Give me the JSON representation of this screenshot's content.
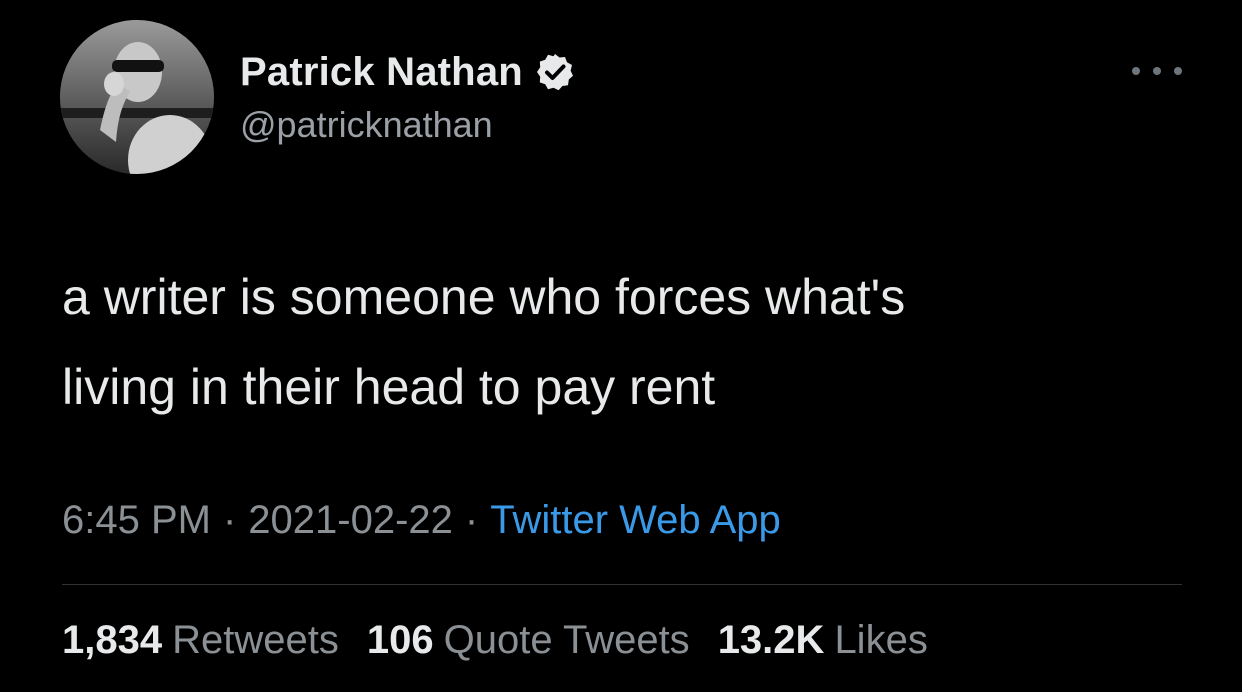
{
  "user": {
    "display_name": "Patrick Nathan",
    "handle": "@patricknathan",
    "verified_icon": "verified-badge-icon"
  },
  "tweet": {
    "text": "a writer is someone who forces what's\nliving in their head to pay rent",
    "time": "6:45 PM",
    "separator": "·",
    "date": "2021-02-22",
    "source": "Twitter Web App"
  },
  "stats": {
    "retweets_count": "1,834",
    "retweets_label": "Retweets",
    "quotes_count": "106",
    "quotes_label": "Quote Tweets",
    "likes_count": "13.2K",
    "likes_label": "Likes"
  },
  "colors": {
    "background": "#000000",
    "text": "#e7e9ea",
    "secondary": "#8b9095",
    "link": "#3b9ae8",
    "divider": "#2f3336"
  }
}
